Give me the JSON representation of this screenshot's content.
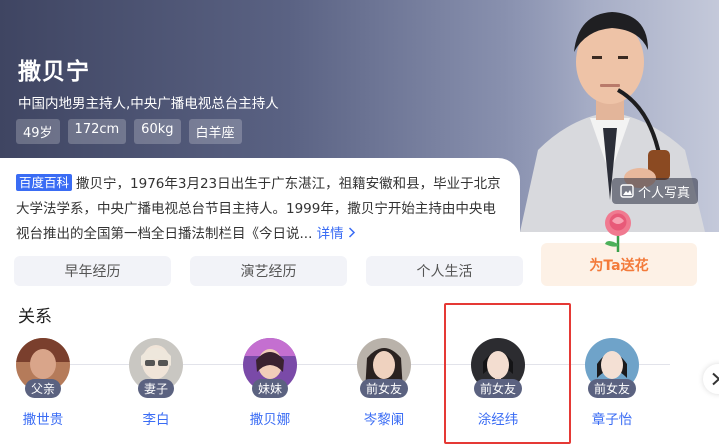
{
  "profile": {
    "name": "撒贝宁",
    "subtitle": "中国内地男主持人,中央广播电视总台主持人",
    "tags": [
      "49岁",
      "172cm",
      "60kg",
      "白羊座"
    ],
    "photo_label": "个人写真"
  },
  "bio": {
    "source_badge": "百度百科",
    "text": "撒贝宁，1976年3月23日出生于广东湛江，祖籍安徽和县，毕业于北京大学法学系，中央广播电视总台节目主持人。1999年，撒贝宁开始主持由中央电视台推出的全国第一档全日播法制栏目《今日说...",
    "more_label": "详情"
  },
  "tabs": [
    "早年经历",
    "演艺经历",
    "个人生活"
  ],
  "gift": {
    "label": "为Ta送花"
  },
  "relations": {
    "title": "关系",
    "people": [
      {
        "relation": "父亲",
        "name": "撒世贵"
      },
      {
        "relation": "妻子",
        "name": "李白"
      },
      {
        "relation": "妹妹",
        "name": "撒贝娜"
      },
      {
        "relation": "前女友",
        "name": "岑黎阑"
      },
      {
        "relation": "前女友",
        "name": "涂经纬"
      },
      {
        "relation": "前女友",
        "name": "章子怡"
      }
    ]
  },
  "colors": {
    "accent": "#3a6cf4",
    "gift": "#f37a3a",
    "highlight": "#e53935",
    "badge_bg": "#5b6280"
  }
}
